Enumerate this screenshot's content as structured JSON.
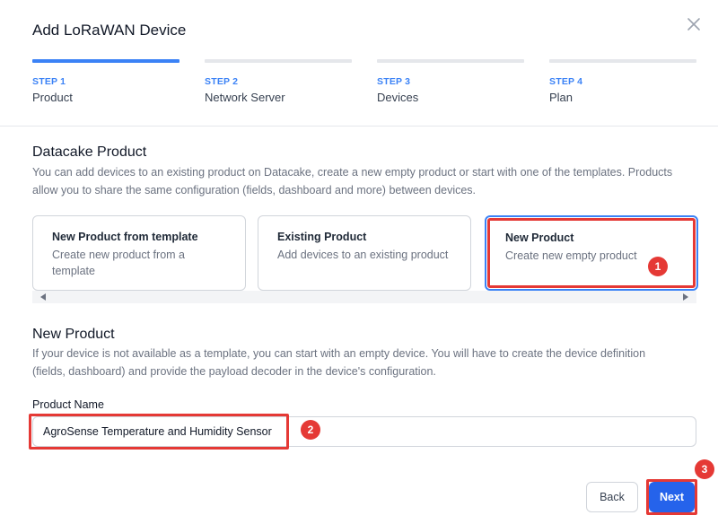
{
  "modal": {
    "title": "Add LoRaWAN Device"
  },
  "steps": [
    {
      "num": "STEP 1",
      "name": "Product"
    },
    {
      "num": "STEP 2",
      "name": "Network Server"
    },
    {
      "num": "STEP 3",
      "name": "Devices"
    },
    {
      "num": "STEP 4",
      "name": "Plan"
    }
  ],
  "datacake": {
    "heading": "Datacake Product",
    "description": "You can add devices to an existing product on Datacake, create a new empty product or start with one of the templates. Products allow you to share the same configuration (fields, dashboard and more) between devices."
  },
  "cards": [
    {
      "title": "New Product from template",
      "subtitle": "Create new product from a template"
    },
    {
      "title": "Existing Product",
      "subtitle": "Add devices to an existing product"
    },
    {
      "title": "New Product",
      "subtitle": "Create new empty product"
    }
  ],
  "new_product": {
    "heading": "New Product",
    "description": "If your device is not available as a template, you can start with an empty device. You will have to create the device definition (fields, dashboard) and provide the payload decoder in the device's configuration."
  },
  "form": {
    "product_name_label": "Product Name",
    "product_name_value": "AgroSense Temperature and Humidity Sensor"
  },
  "buttons": {
    "back": "Back",
    "next": "Next"
  },
  "annotations": [
    "1",
    "2",
    "3"
  ],
  "colors": {
    "accent": "#3b82f6",
    "primary_button": "#2563eb",
    "annotation_red": "#e53935"
  },
  "icons": {
    "close": "close-icon",
    "scroll_left": "chevron-left-icon",
    "scroll_right": "chevron-right-icon"
  }
}
